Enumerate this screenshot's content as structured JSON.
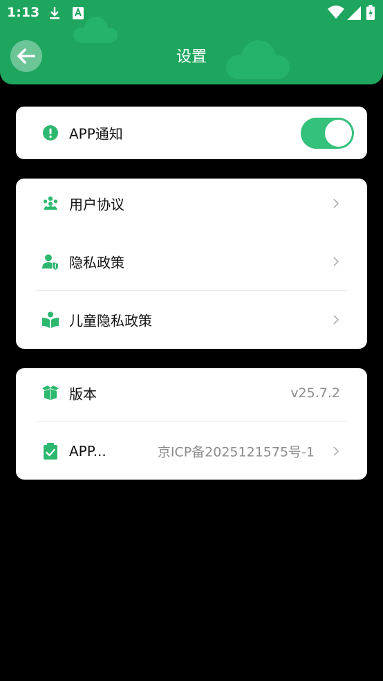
{
  "status_bar": {
    "time": "1:13"
  },
  "header": {
    "title": "设置"
  },
  "notification": {
    "label": "APP通知",
    "enabled": true
  },
  "policies": [
    {
      "label": "用户协议"
    },
    {
      "label": "隐私政策"
    },
    {
      "label": "儿童隐私政策"
    }
  ],
  "info": {
    "version_label": "版本",
    "version_value": "v25.7.2",
    "record_label": "APP...",
    "record_value": "京ICP备2025121575号-1"
  },
  "colors": {
    "header": "#1ea65f",
    "accent": "#34c17b",
    "icon": "#2db86f"
  }
}
